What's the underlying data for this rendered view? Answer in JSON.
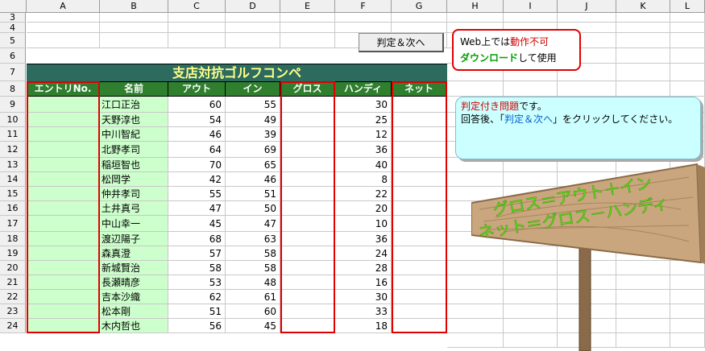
{
  "columns": [
    "A",
    "B",
    "C",
    "D",
    "E",
    "F",
    "G",
    "H",
    "I",
    "J",
    "K",
    "L"
  ],
  "rows": [
    "3",
    "4",
    "5",
    "6",
    "7",
    "8",
    "9",
    "10",
    "11",
    "12",
    "13",
    "14",
    "15",
    "16",
    "17",
    "18",
    "19",
    "20",
    "21",
    "22",
    "23",
    "24"
  ],
  "judge_button": "判定＆次へ",
  "notice": {
    "line1_prefix": "Web上では",
    "line1_red": "動作不可",
    "line2_green": "ダウンロード",
    "line2_suffix": "して使用"
  },
  "title": "支店対抗ゴルフコンペ",
  "headers": [
    "エントリNo.",
    "名前",
    "アウト",
    "イン",
    "グロス",
    "ハンディ",
    "ネット"
  ],
  "players": [
    {
      "name": "江口正治",
      "out": 60,
      "in": 55,
      "handicap": 30
    },
    {
      "name": "天野淳也",
      "out": 54,
      "in": 49,
      "handicap": 25
    },
    {
      "name": "中川智紀",
      "out": 46,
      "in": 39,
      "handicap": 12
    },
    {
      "name": "北野孝司",
      "out": 64,
      "in": 69,
      "handicap": 36
    },
    {
      "name": "稲垣智也",
      "out": 70,
      "in": 65,
      "handicap": 40
    },
    {
      "name": "松岡学",
      "out": 42,
      "in": 46,
      "handicap": 8
    },
    {
      "name": "仲井孝司",
      "out": 55,
      "in": 51,
      "handicap": 22
    },
    {
      "name": "土井真弓",
      "out": 47,
      "in": 50,
      "handicap": 20
    },
    {
      "name": "中山幸一",
      "out": 45,
      "in": 47,
      "handicap": 10
    },
    {
      "name": "渡辺陽子",
      "out": 68,
      "in": 63,
      "handicap": 36
    },
    {
      "name": "森真澄",
      "out": 57,
      "in": 58,
      "handicap": 24
    },
    {
      "name": "新城賢治",
      "out": 58,
      "in": 58,
      "handicap": 28
    },
    {
      "name": "長瀬晴彦",
      "out": 53,
      "in": 48,
      "handicap": 16
    },
    {
      "name": "吉本沙織",
      "out": 62,
      "in": 61,
      "handicap": 30
    },
    {
      "name": "松本剛",
      "out": 51,
      "in": 60,
      "handicap": 33
    },
    {
      "name": "木内哲也",
      "out": 56,
      "in": 45,
      "handicap": 18
    }
  ],
  "instructions": {
    "line1_red": "判定付き問題",
    "line1_suffix": "です。",
    "line2_prefix": "回答後、「",
    "line2_blue": "判定＆次へ",
    "line2_suffix": "」をクリックしてください。"
  },
  "sign": {
    "line1": "グロス＝アウト＋イン",
    "line2": "ネット＝グロス－ハンディ"
  }
}
